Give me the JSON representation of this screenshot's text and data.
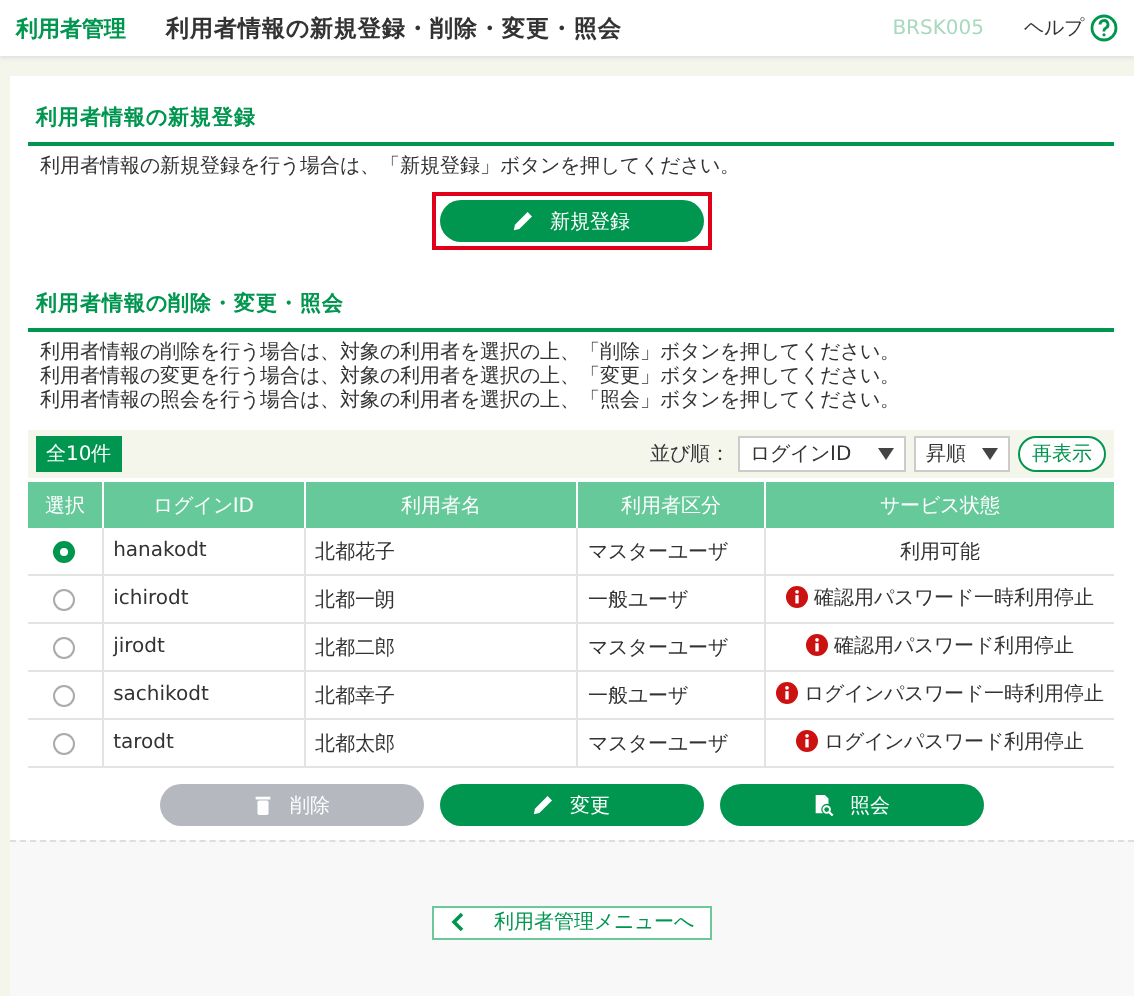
{
  "header": {
    "app_title": "利用者管理",
    "page_title": "利用者情報の新規登録・削除・変更・照会",
    "screen_id": "BRSK005",
    "help": "ヘルプ"
  },
  "register": {
    "title": "利用者情報の新規登録",
    "description": "利用者情報の新規登録を行う場合は、「新規登録」ボタンを押してください。",
    "button": {
      "label": "新規登録",
      "highlighted": true
    }
  },
  "manage": {
    "title": "利用者情報の削除・変更・照会",
    "descriptions": [
      "利用者情報の削除を行う場合は、対象の利用者を選択の上、「削除」ボタンを押してください。",
      "利用者情報の変更を行う場合は、対象の利用者を選択の上、「変更」ボタンを押してください。",
      "利用者情報の照会を行う場合は、対象の利用者を選択の上、「照会」ボタンを押してください。"
    ],
    "count": "全10件",
    "sort_label": "並び順：",
    "sort_field": "ログインID",
    "sort_order": "昇順",
    "refresh": "再表示",
    "table": {
      "columns": [
        "選択",
        "ログインID",
        "利用者名",
        "利用者区分",
        "サービス状態"
      ],
      "rows": [
        {
          "selected": true,
          "login_id": "hanakodt",
          "name": "北都花子",
          "type": "マスターユーザ",
          "status": {
            "kind": "ok",
            "text": "利用可能"
          }
        },
        {
          "selected": false,
          "login_id": "ichirodt",
          "name": "北都一朗",
          "type": "一般ユーザ",
          "status": {
            "kind": "warning",
            "text": "確認用パスワード一時利用停止"
          }
        },
        {
          "selected": false,
          "login_id": "jirodt",
          "name": "北都二郎",
          "type": "マスターユーザ",
          "status": {
            "kind": "warning",
            "text": "確認用パスワード利用停止"
          }
        },
        {
          "selected": false,
          "login_id": "sachikodt",
          "name": "北都幸子",
          "type": "一般ユーザ",
          "status": {
            "kind": "warning",
            "text": "ログインパスワード一時利用停止"
          }
        },
        {
          "selected": false,
          "login_id": "tarodt",
          "name": "北都太郎",
          "type": "マスターユーザ",
          "status": {
            "kind": "warning",
            "text": "ログインパスワード利用停止"
          }
        }
      ]
    },
    "actions": [
      {
        "kind": "delete",
        "label": "削除",
        "disabled": true
      },
      {
        "kind": "edit",
        "label": "変更",
        "disabled": false
      },
      {
        "kind": "view",
        "label": "照会",
        "disabled": false
      }
    ]
  },
  "back_button": "利用者管理メニューへ"
}
